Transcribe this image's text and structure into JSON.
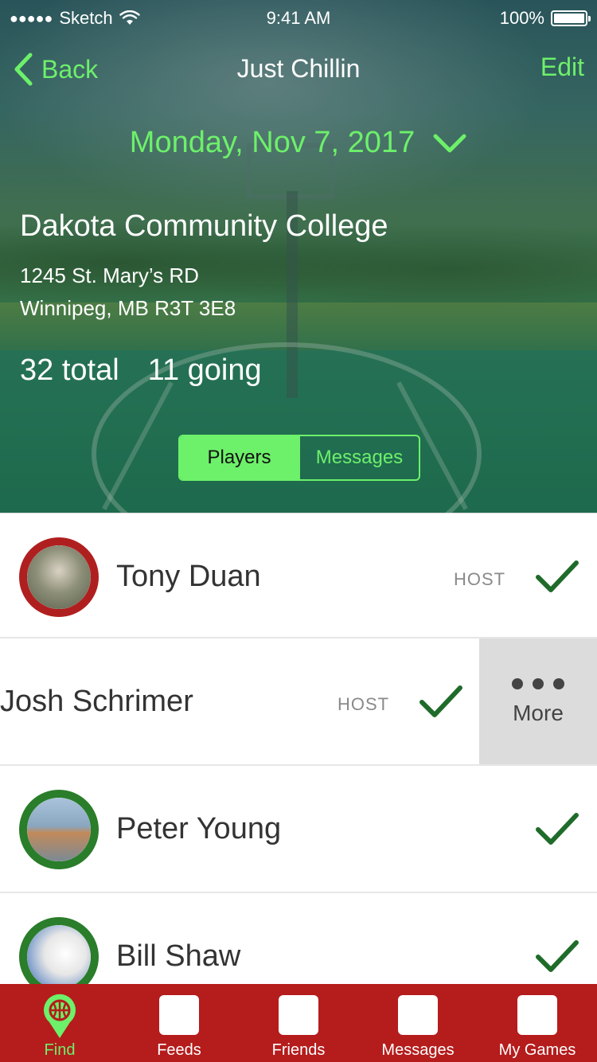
{
  "status_bar": {
    "signal_dots": "●●●●●",
    "carrier": "Sketch",
    "time": "9:41 AM",
    "battery_percent": "100%",
    "battery_level": 1.0
  },
  "nav": {
    "back_label": "Back",
    "title": "Just Chillin",
    "edit_label": "Edit"
  },
  "event": {
    "date": "Monday, Nov 7, 2017",
    "venue": "Dakota Community College",
    "address_line1": "1245 St. Mary’s RD",
    "address_line2": "Winnipeg, MB R3T 3E8",
    "total": "32 total",
    "going": "11 going"
  },
  "segment": {
    "players": "Players",
    "messages": "Messages",
    "selected": "Players"
  },
  "players": [
    {
      "name": "Tony Duan",
      "badge": "HOST",
      "going": true
    },
    {
      "name": "Josh Schrimer",
      "badge": "HOST",
      "going": true,
      "swipe_action": "More"
    },
    {
      "name": "Peter Young",
      "badge": "",
      "going": true
    },
    {
      "name": "Bill Shaw",
      "badge": "",
      "going": true
    }
  ],
  "tabbar": {
    "tabs": [
      {
        "label": "Find",
        "active": true
      },
      {
        "label": "Feeds",
        "active": false
      },
      {
        "label": "Friends",
        "active": false
      },
      {
        "label": "Messages",
        "active": false
      },
      {
        "label": "My Games",
        "active": false
      }
    ]
  },
  "colors": {
    "accent_green": "#6df06a",
    "check_green": "#1f6b2a",
    "tabbar_red": "#b51c1c",
    "host_avatar_ring": "#b01f1f",
    "player_avatar_ring": "#2a7d2a"
  }
}
